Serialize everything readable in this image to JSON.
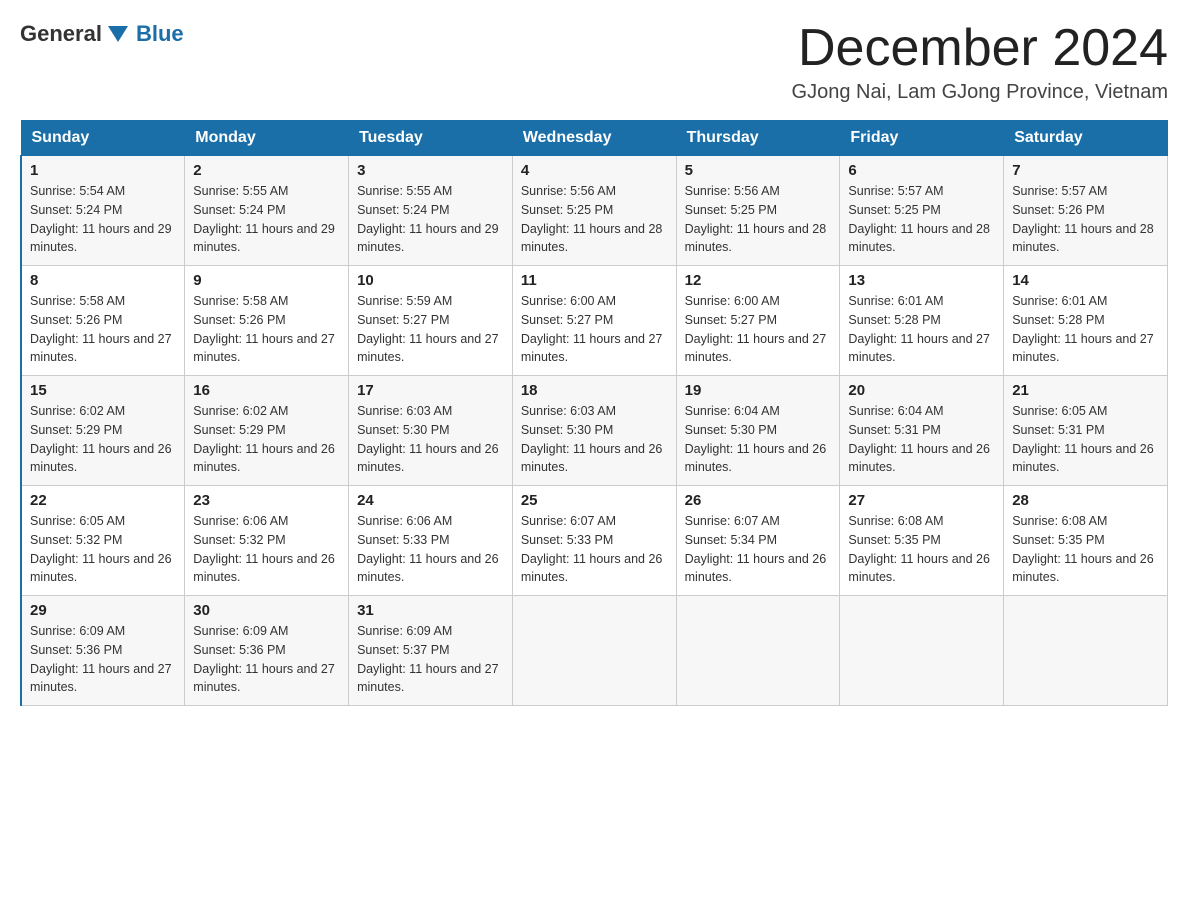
{
  "logo": {
    "text_general": "General",
    "text_blue": "Blue",
    "arrow_color": "#1a6fa8"
  },
  "title": "December 2024",
  "subtitle": "GJong Nai, Lam GJong Province, Vietnam",
  "days_of_week": [
    "Sunday",
    "Monday",
    "Tuesday",
    "Wednesday",
    "Thursday",
    "Friday",
    "Saturday"
  ],
  "weeks": [
    [
      {
        "day": "1",
        "sunrise": "5:54 AM",
        "sunset": "5:24 PM",
        "daylight": "11 hours and 29 minutes."
      },
      {
        "day": "2",
        "sunrise": "5:55 AM",
        "sunset": "5:24 PM",
        "daylight": "11 hours and 29 minutes."
      },
      {
        "day": "3",
        "sunrise": "5:55 AM",
        "sunset": "5:24 PM",
        "daylight": "11 hours and 29 minutes."
      },
      {
        "day": "4",
        "sunrise": "5:56 AM",
        "sunset": "5:25 PM",
        "daylight": "11 hours and 28 minutes."
      },
      {
        "day": "5",
        "sunrise": "5:56 AM",
        "sunset": "5:25 PM",
        "daylight": "11 hours and 28 minutes."
      },
      {
        "day": "6",
        "sunrise": "5:57 AM",
        "sunset": "5:25 PM",
        "daylight": "11 hours and 28 minutes."
      },
      {
        "day": "7",
        "sunrise": "5:57 AM",
        "sunset": "5:26 PM",
        "daylight": "11 hours and 28 minutes."
      }
    ],
    [
      {
        "day": "8",
        "sunrise": "5:58 AM",
        "sunset": "5:26 PM",
        "daylight": "11 hours and 27 minutes."
      },
      {
        "day": "9",
        "sunrise": "5:58 AM",
        "sunset": "5:26 PM",
        "daylight": "11 hours and 27 minutes."
      },
      {
        "day": "10",
        "sunrise": "5:59 AM",
        "sunset": "5:27 PM",
        "daylight": "11 hours and 27 minutes."
      },
      {
        "day": "11",
        "sunrise": "6:00 AM",
        "sunset": "5:27 PM",
        "daylight": "11 hours and 27 minutes."
      },
      {
        "day": "12",
        "sunrise": "6:00 AM",
        "sunset": "5:27 PM",
        "daylight": "11 hours and 27 minutes."
      },
      {
        "day": "13",
        "sunrise": "6:01 AM",
        "sunset": "5:28 PM",
        "daylight": "11 hours and 27 minutes."
      },
      {
        "day": "14",
        "sunrise": "6:01 AM",
        "sunset": "5:28 PM",
        "daylight": "11 hours and 27 minutes."
      }
    ],
    [
      {
        "day": "15",
        "sunrise": "6:02 AM",
        "sunset": "5:29 PM",
        "daylight": "11 hours and 26 minutes."
      },
      {
        "day": "16",
        "sunrise": "6:02 AM",
        "sunset": "5:29 PM",
        "daylight": "11 hours and 26 minutes."
      },
      {
        "day": "17",
        "sunrise": "6:03 AM",
        "sunset": "5:30 PM",
        "daylight": "11 hours and 26 minutes."
      },
      {
        "day": "18",
        "sunrise": "6:03 AM",
        "sunset": "5:30 PM",
        "daylight": "11 hours and 26 minutes."
      },
      {
        "day": "19",
        "sunrise": "6:04 AM",
        "sunset": "5:30 PM",
        "daylight": "11 hours and 26 minutes."
      },
      {
        "day": "20",
        "sunrise": "6:04 AM",
        "sunset": "5:31 PM",
        "daylight": "11 hours and 26 minutes."
      },
      {
        "day": "21",
        "sunrise": "6:05 AM",
        "sunset": "5:31 PM",
        "daylight": "11 hours and 26 minutes."
      }
    ],
    [
      {
        "day": "22",
        "sunrise": "6:05 AM",
        "sunset": "5:32 PM",
        "daylight": "11 hours and 26 minutes."
      },
      {
        "day": "23",
        "sunrise": "6:06 AM",
        "sunset": "5:32 PM",
        "daylight": "11 hours and 26 minutes."
      },
      {
        "day": "24",
        "sunrise": "6:06 AM",
        "sunset": "5:33 PM",
        "daylight": "11 hours and 26 minutes."
      },
      {
        "day": "25",
        "sunrise": "6:07 AM",
        "sunset": "5:33 PM",
        "daylight": "11 hours and 26 minutes."
      },
      {
        "day": "26",
        "sunrise": "6:07 AM",
        "sunset": "5:34 PM",
        "daylight": "11 hours and 26 minutes."
      },
      {
        "day": "27",
        "sunrise": "6:08 AM",
        "sunset": "5:35 PM",
        "daylight": "11 hours and 26 minutes."
      },
      {
        "day": "28",
        "sunrise": "6:08 AM",
        "sunset": "5:35 PM",
        "daylight": "11 hours and 26 minutes."
      }
    ],
    [
      {
        "day": "29",
        "sunrise": "6:09 AM",
        "sunset": "5:36 PM",
        "daylight": "11 hours and 27 minutes."
      },
      {
        "day": "30",
        "sunrise": "6:09 AM",
        "sunset": "5:36 PM",
        "daylight": "11 hours and 27 minutes."
      },
      {
        "day": "31",
        "sunrise": "6:09 AM",
        "sunset": "5:37 PM",
        "daylight": "11 hours and 27 minutes."
      },
      null,
      null,
      null,
      null
    ]
  ]
}
